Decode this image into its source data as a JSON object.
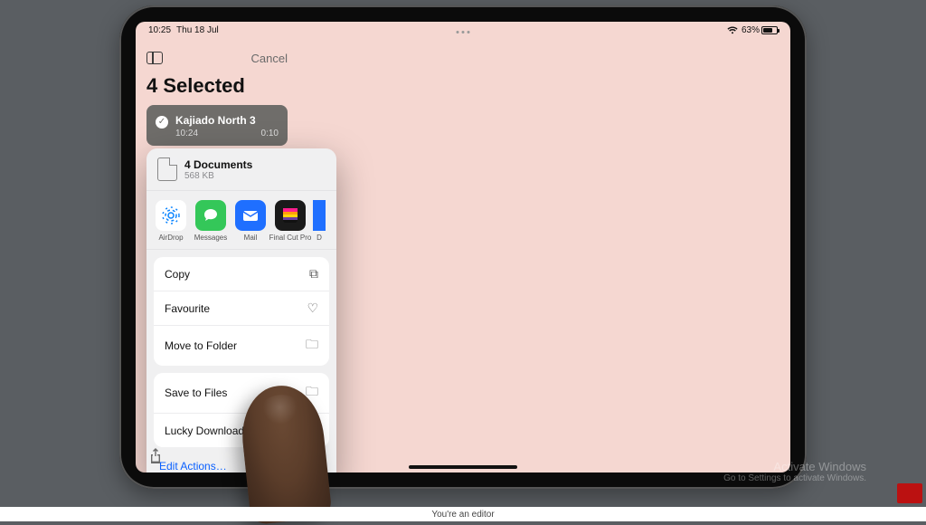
{
  "status": {
    "time": "10:25",
    "date": "Thu 18 Jul",
    "battery_pct": "63%"
  },
  "toolbar": {
    "cancel": "Cancel"
  },
  "selection": {
    "title": "4 Selected",
    "item_title": "Kajiado North 3",
    "item_time": "10:24",
    "item_duration": "0:10"
  },
  "share": {
    "doc_count": "4 Documents",
    "doc_size": "568 KB",
    "apps": [
      {
        "name": "AirDrop",
        "icon": "airdrop"
      },
      {
        "name": "Messages",
        "icon": "messages"
      },
      {
        "name": "Mail",
        "icon": "mail"
      },
      {
        "name": "Final Cut Pro",
        "icon": "fcp"
      },
      {
        "name": "D",
        "icon": "extra"
      }
    ],
    "actions1": [
      {
        "label": "Copy",
        "glyph": "⧉"
      },
      {
        "label": "Favourite",
        "glyph": "♡"
      },
      {
        "label": "Move to Folder",
        "glyph": "🗀"
      }
    ],
    "actions2": [
      {
        "label": "Save to Files",
        "glyph": "🗀"
      },
      {
        "label": "Lucky Downloader",
        "glyph": "◉"
      }
    ],
    "edit_actions": "Edit Actions…"
  },
  "watermark": {
    "line1": "Activate Windows",
    "line2": "Go to Settings to activate Windows."
  },
  "footer": "You're an editor"
}
